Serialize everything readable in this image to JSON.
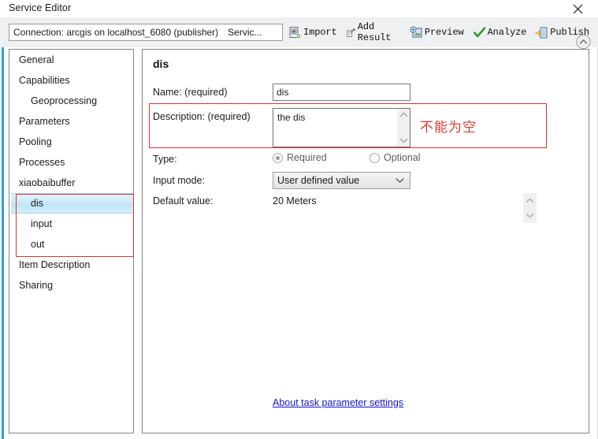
{
  "window": {
    "title": "Service Editor",
    "close_icon": "close-icon"
  },
  "toolbar": {
    "connection_text": "Connection: arcgis on localhost_6080 (publisher)",
    "connection_suffix": "Servic...",
    "items": [
      {
        "label": "Import",
        "icon": "import-icon"
      },
      {
        "label": "Add Result",
        "icon": "add-result-icon"
      },
      {
        "label": "Preview",
        "icon": "preview-icon"
      },
      {
        "label": "Analyze",
        "icon": "analyze-check-icon"
      },
      {
        "label": "Publish",
        "icon": "publish-icon"
      }
    ],
    "collapse_icon": "chevron-up-circle-icon"
  },
  "sidebar": {
    "items": [
      {
        "label": "General",
        "level": 0,
        "selected": false
      },
      {
        "label": "Capabilities",
        "level": 0,
        "selected": false
      },
      {
        "label": "Geoprocessing",
        "level": 1,
        "selected": false
      },
      {
        "label": "Parameters",
        "level": 0,
        "selected": false
      },
      {
        "label": "Pooling",
        "level": 0,
        "selected": false
      },
      {
        "label": "Processes",
        "level": 0,
        "selected": false
      },
      {
        "label": "xiaobaibuffer",
        "level": 0,
        "selected": false
      },
      {
        "label": "dis",
        "level": 1,
        "selected": true
      },
      {
        "label": "input",
        "level": 1,
        "selected": false
      },
      {
        "label": "out",
        "level": 1,
        "selected": false
      },
      {
        "label": "Item Description",
        "level": 0,
        "selected": false
      },
      {
        "label": "Sharing",
        "level": 0,
        "selected": false
      }
    ]
  },
  "main": {
    "heading": "dis",
    "name_label": "Name:  (required)",
    "name_value": "dis",
    "description_label": "Description:  (required)",
    "description_value": "the dis",
    "type_label": "Type:",
    "type_options": [
      {
        "label": "Required",
        "checked": true
      },
      {
        "label": "Optional",
        "checked": false
      }
    ],
    "input_mode_label": "Input mode:",
    "input_mode_value": "User defined value",
    "default_value_label": "Default value:",
    "default_value": "20 Meters",
    "about_link": "About task parameter settings"
  },
  "annotations": {
    "note_text": "不能为空",
    "note_color": "#e23b32",
    "box_color": "#e03232"
  },
  "icons": {
    "scroll_up": "chevron-up-icon",
    "scroll_down": "chevron-down-icon",
    "combo_arrow": "chevron-down-icon"
  }
}
